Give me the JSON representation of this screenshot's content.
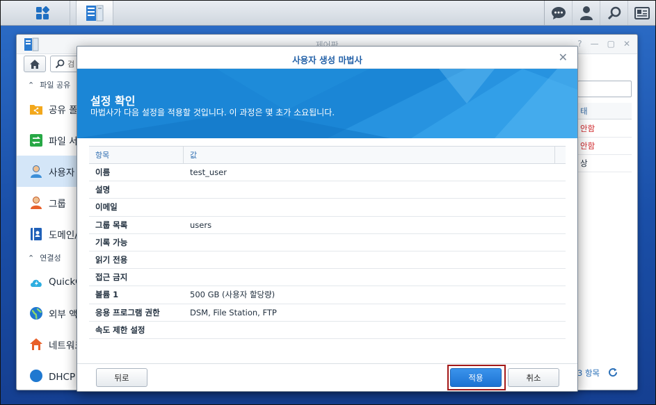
{
  "taskbar": {
    "icons": [
      "main-menu-icon",
      "control-panel-app-icon",
      "chat-icon",
      "user-icon",
      "search-icon",
      "widgets-icon"
    ]
  },
  "control_panel": {
    "title": "제어판",
    "search_placeholder": "검",
    "sidebar": {
      "section_file_sharing": "파일 공유",
      "items": [
        {
          "label": "공유 폴",
          "icon": "shared-folder-icon"
        },
        {
          "label": "파일 서",
          "icon": "file-service-icon"
        },
        {
          "label": "사용자",
          "icon": "user-icon"
        },
        {
          "label": "그룹",
          "icon": "group-icon"
        },
        {
          "label": "도메인/",
          "icon": "domain-icon"
        }
      ],
      "section_connectivity": "연결성",
      "items2": [
        {
          "label": "QuickC",
          "icon": "quickconnect-icon"
        },
        {
          "label": "외부 액",
          "icon": "external-access-icon"
        },
        {
          "label": "네트워크",
          "icon": "network-icon"
        },
        {
          "label": "DHCP 서",
          "icon": "dhcp-icon"
        }
      ]
    },
    "status_column_header": "태",
    "status_rows": [
      "안함",
      "안함",
      "상"
    ],
    "footer_count": "3 항목",
    "status_color": "#d0262a"
  },
  "wizard": {
    "title": "사용자 생성 마법사",
    "banner_title": "설정 확인",
    "banner_desc": "마법사가 다음 설정을 적용할 것입니다. 이 과정은 몇 초가 소요됩니다.",
    "grid_headers": {
      "item": "항목",
      "value": "값"
    },
    "rows": [
      {
        "item": "이름",
        "value": "test_user"
      },
      {
        "item": "설명",
        "value": ""
      },
      {
        "item": "이메일",
        "value": ""
      },
      {
        "item": "그룹 목록",
        "value": "users"
      },
      {
        "item": "기록 가능",
        "value": ""
      },
      {
        "item": "읽기 전용",
        "value": ""
      },
      {
        "item": "접근 금지",
        "value": ""
      },
      {
        "item": "볼륨 1",
        "value": "500 GB (사용자 할당량)"
      },
      {
        "item": "응용 프로그램 권한",
        "value": "DSM, File Station, FTP"
      },
      {
        "item": "속도 제한 설정",
        "value": ""
      }
    ],
    "buttons": {
      "back": "뒤로",
      "apply": "적용",
      "cancel": "취소"
    },
    "accent_color": "#1b86d6"
  }
}
